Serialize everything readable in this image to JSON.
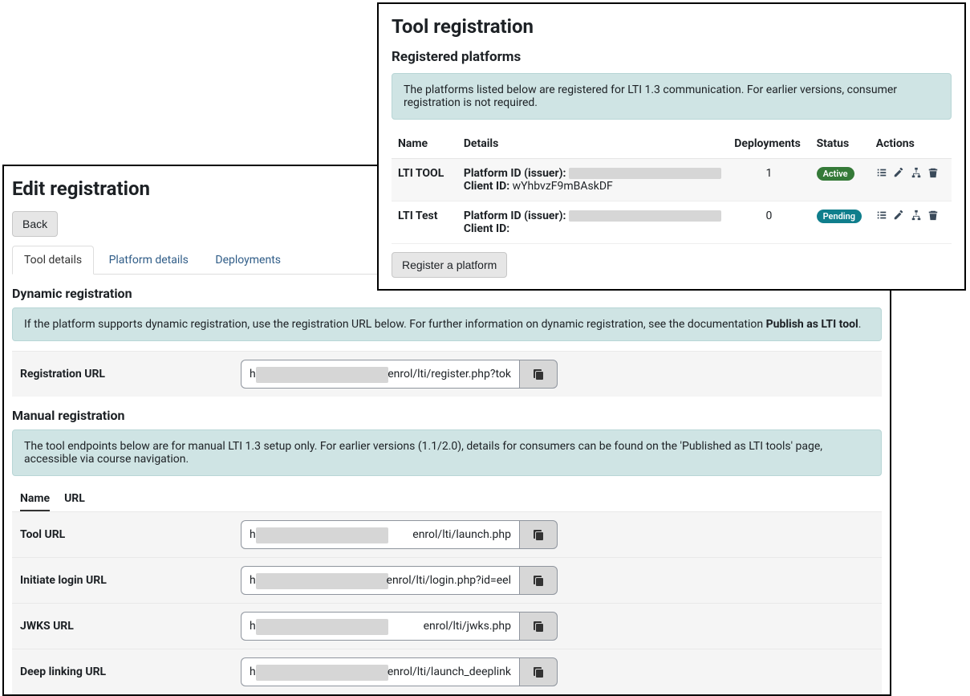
{
  "top": {
    "title": "Tool registration",
    "subtitle": "Registered platforms",
    "banner": "The platforms listed below are registered for LTI 1.3 communication. For earlier versions, consumer registration is not required.",
    "headers": {
      "name": "Name",
      "details": "Details",
      "deployments": "Deployments",
      "status": "Status",
      "actions": "Actions"
    },
    "rows": [
      {
        "name": "LTI TOOL",
        "platform_label": "Platform ID (issuer):",
        "platform_value": "",
        "client_label": "Client ID:",
        "client_value": "wYhbvzF9mBAskDF",
        "deployments": "1",
        "status": "Active",
        "status_kind": "active"
      },
      {
        "name": "LTI Test",
        "platform_label": "Platform ID (issuer):",
        "platform_value": "",
        "client_label": "Client ID:",
        "client_value": "",
        "deployments": "0",
        "status": "Pending",
        "status_kind": "pending"
      }
    ],
    "register_button": "Register a platform"
  },
  "bottom": {
    "title": "Edit registration",
    "back": "Back",
    "tabs": [
      "Tool details",
      "Platform details",
      "Deployments"
    ],
    "active_tab": 0,
    "dynamic": {
      "heading": "Dynamic registration",
      "banner_prefix": "If the platform supports dynamic registration, use the registration URL below. For further information on dynamic registration, see the documentation ",
      "banner_bold": "Publish as LTI tool",
      "banner_suffix": ".",
      "field_label": "Registration URL",
      "url_prefix": "h",
      "url_suffix": "enrol/lti/register.php?tok"
    },
    "manual": {
      "heading": "Manual registration",
      "banner": "The tool endpoints below are for manual LTI 1.3 setup only. For earlier versions (1.1/2.0), details for consumers can be found on the 'Published as LTI tools' page, accessible via course navigation.",
      "col_name": "Name",
      "col_url": "URL",
      "rows": [
        {
          "label": "Tool URL",
          "prefix": "h",
          "suffix": "enrol/lti/launch.php"
        },
        {
          "label": "Initiate login URL",
          "prefix": "h",
          "suffix": "enrol/lti/login.php?id=eel"
        },
        {
          "label": "JWKS URL",
          "prefix": "h",
          "suffix": "enrol/lti/jwks.php"
        },
        {
          "label": "Deep linking URL",
          "prefix": "h",
          "suffix": "enrol/lti/launch_deeplink"
        }
      ]
    }
  }
}
